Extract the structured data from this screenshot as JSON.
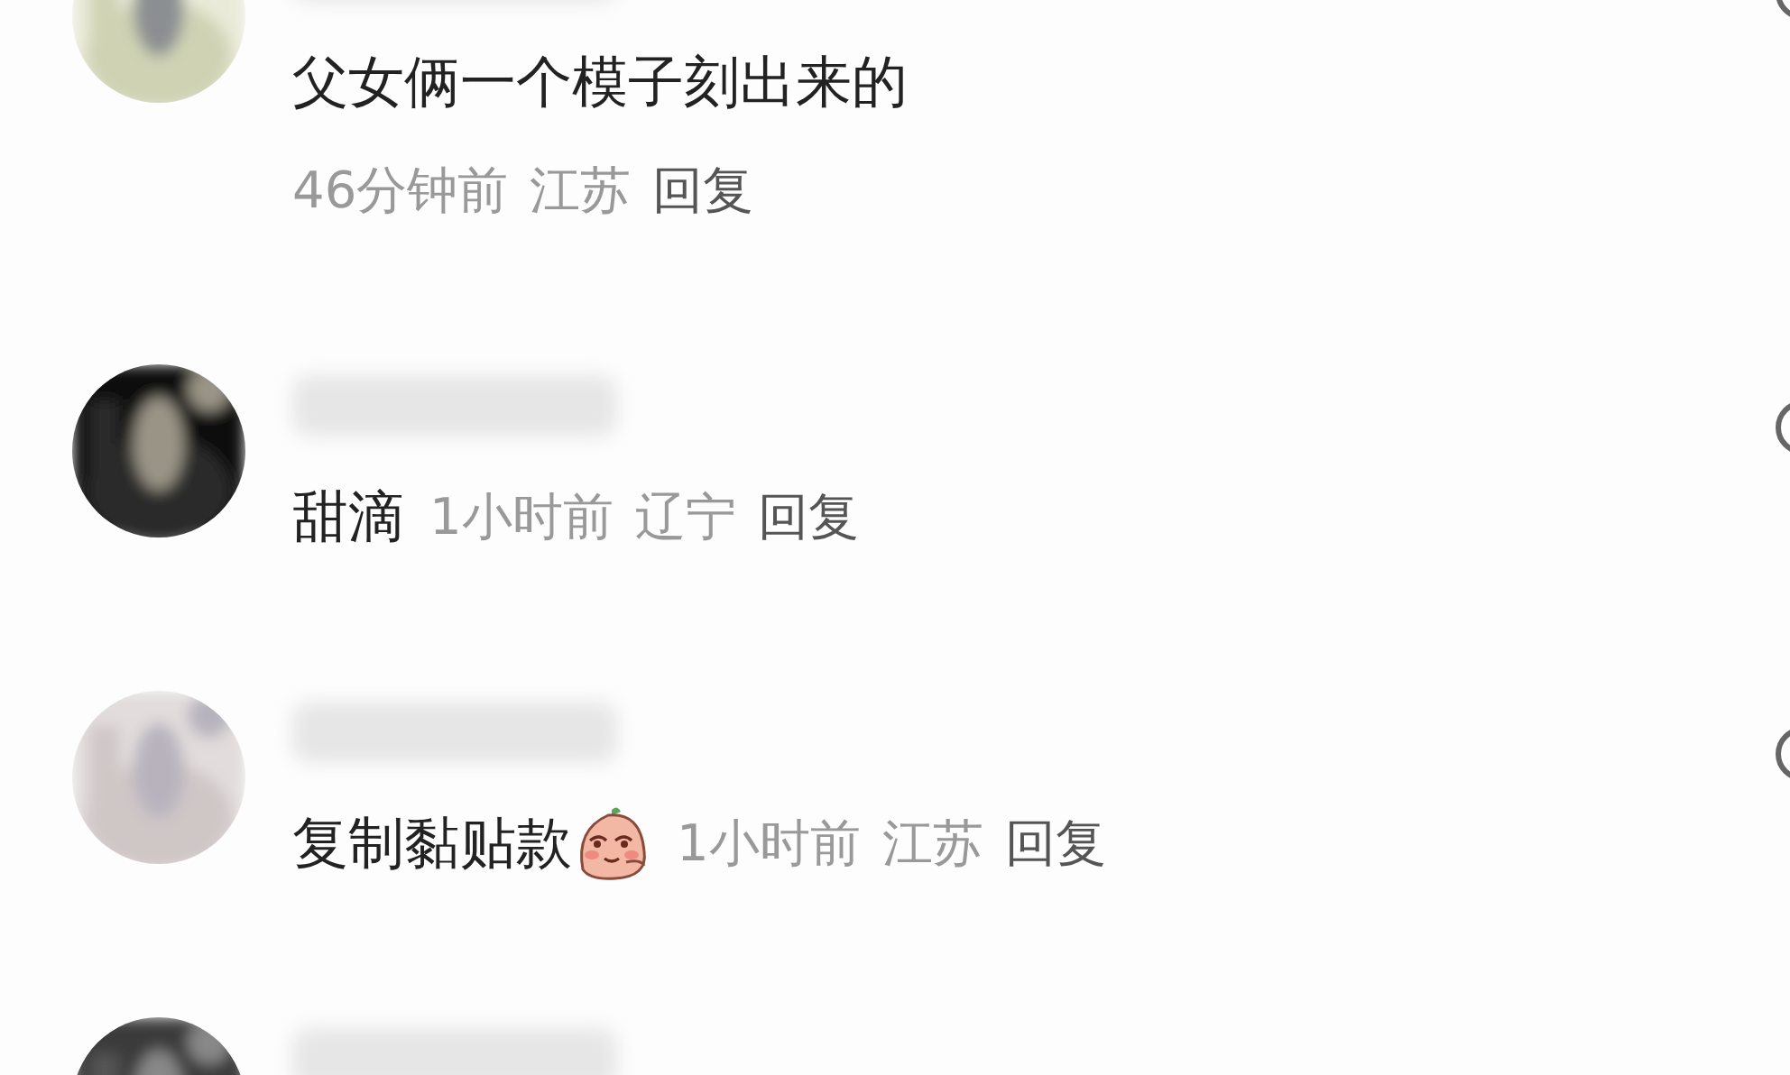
{
  "comments": [
    {
      "kind": "stacked",
      "text": "父女俩一个模子刻出来的",
      "sticker": false,
      "time": "46分钟前",
      "location": "江苏",
      "reply": "回复"
    },
    {
      "kind": "inline",
      "text": "甜滴",
      "sticker": false,
      "time": "1小时前",
      "location": "辽宁",
      "reply": "回复"
    },
    {
      "kind": "inline",
      "text": "复制黏贴款",
      "sticker": true,
      "time": "1小时前",
      "location": "江苏",
      "reply": "回复"
    },
    {
      "kind": "partial"
    }
  ]
}
